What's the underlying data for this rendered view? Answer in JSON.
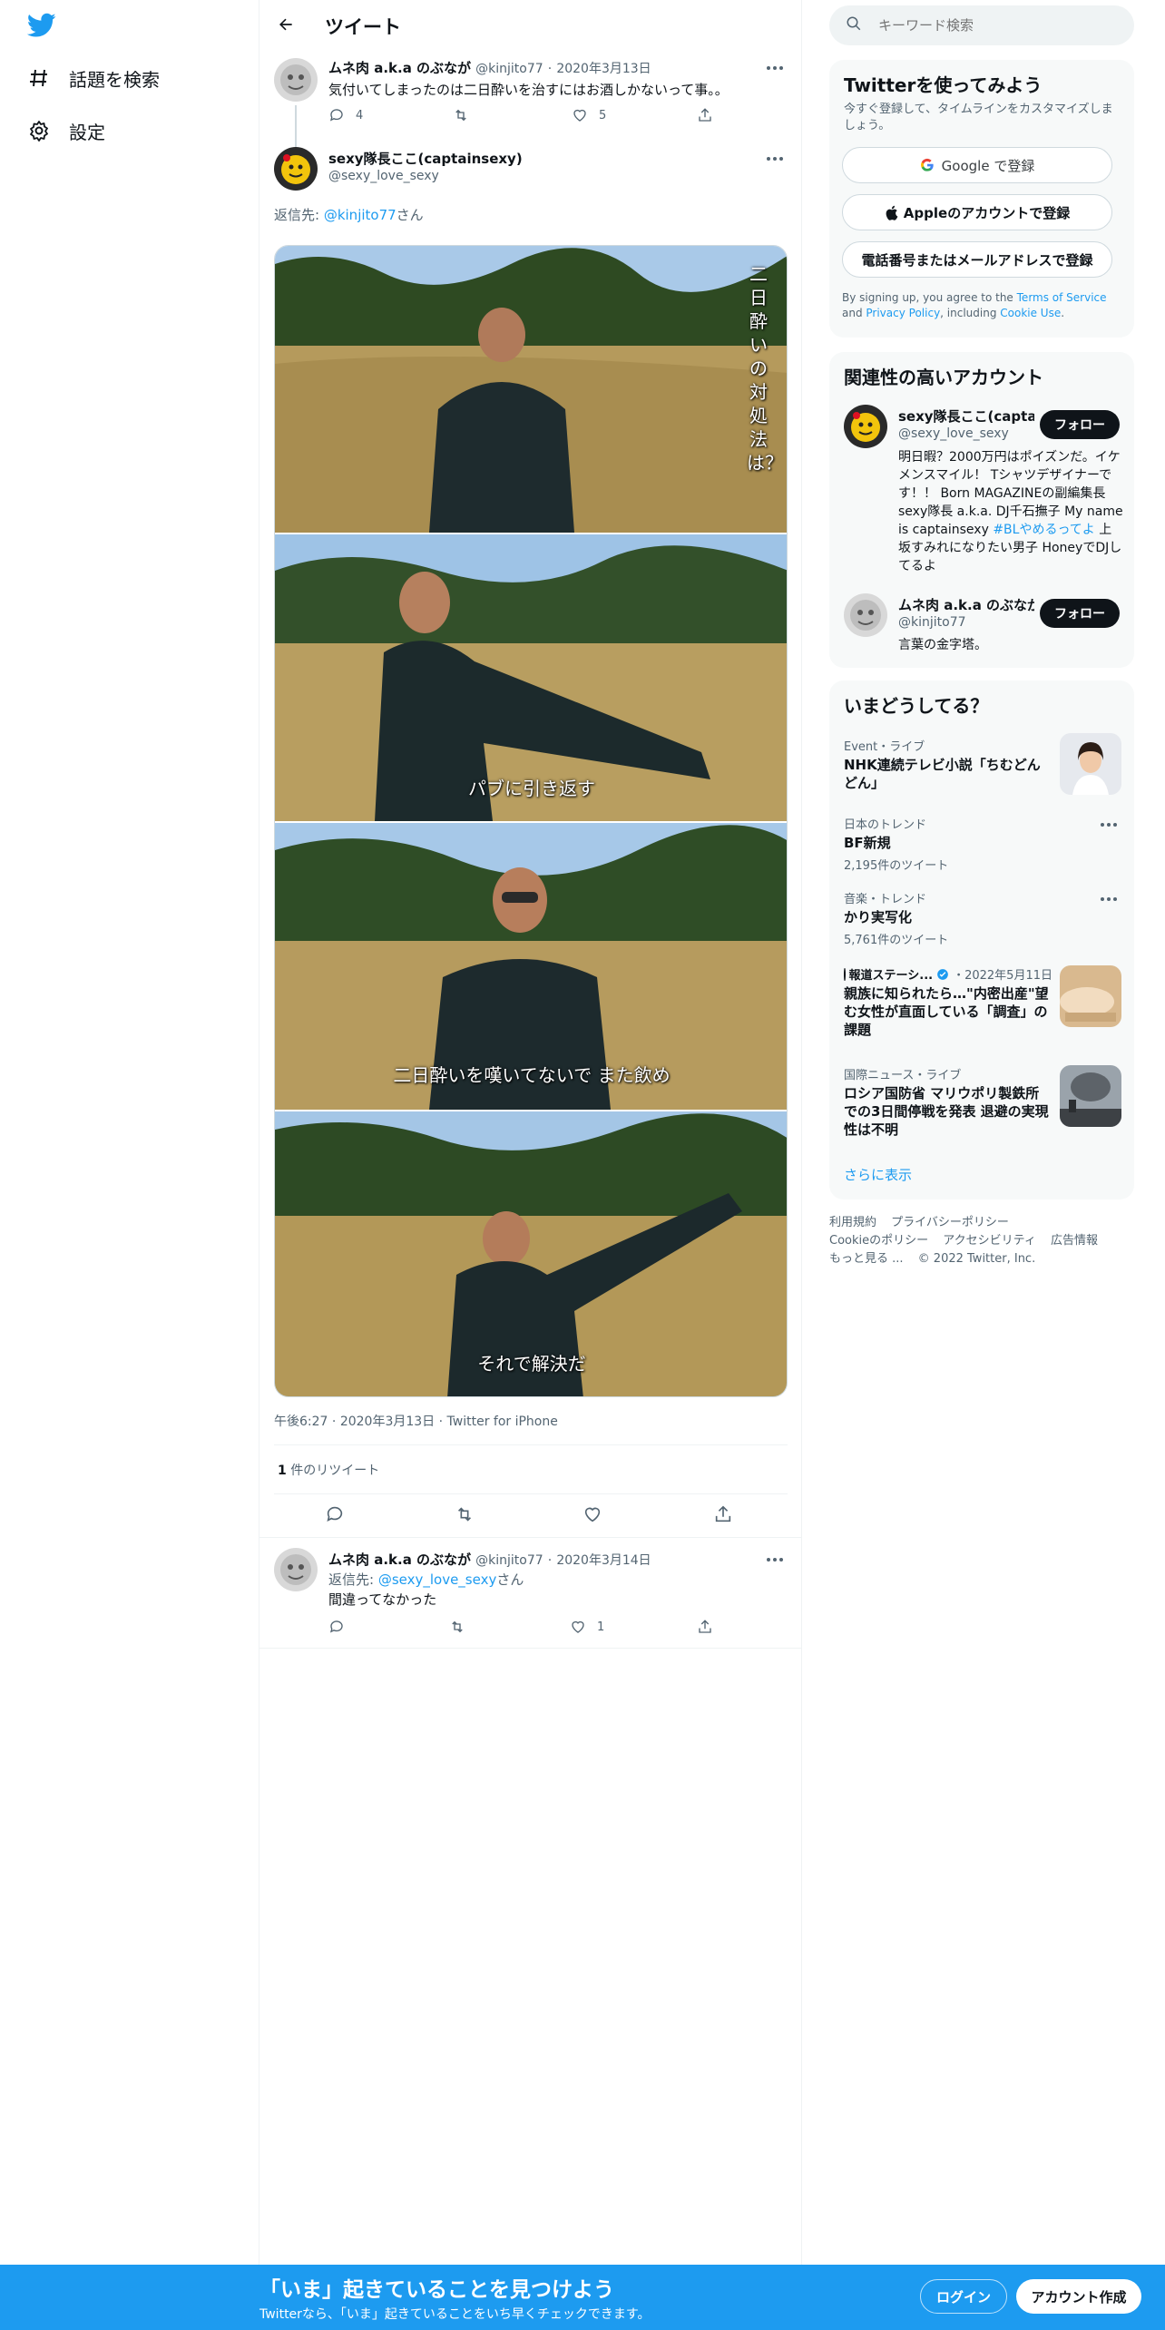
{
  "nav": {
    "explore_label": "話題を検索",
    "settings_label": "設定"
  },
  "header": {
    "title": "ツイート"
  },
  "parent_tweet": {
    "name": "ムネ肉 a.k.a のぶなが",
    "handle": "@kinjito77",
    "sep": "·",
    "date": "2020年3月13日",
    "text": "気付いてしまったのは二日酔いを治すにはお酒しかないって事。。",
    "reply_count": "4",
    "retweet_count": "",
    "like_count": "5"
  },
  "main_tweet": {
    "name": "sexy隊長ここ(captainsexy)",
    "handle": "@sexy_love_sexy",
    "reply_to_prefix": "返信先: ",
    "reply_to_handle": "@kinjito77",
    "reply_to_suffix": "さん",
    "captions": [
      "二日酔いの対処法は？",
      "パブに引き返す",
      "二日酔いを嘆いてないで また飲め",
      "それで解決だ"
    ],
    "timestamp": "午後6:27",
    "date": "2020年3月13日",
    "source": "Twitter for iPhone",
    "sep": "·",
    "retweet_count": "1",
    "retweet_label": " 件のリツイート"
  },
  "reply_tweet": {
    "name": "ムネ肉 a.k.a のぶなが",
    "handle": "@kinjito77",
    "sep": "·",
    "date": "2020年3月14日",
    "reply_to_prefix": "返信先: ",
    "reply_to_handle": "@sexy_love_sexy",
    "reply_to_suffix": "さん",
    "text": "間違ってなかった",
    "reply_count": "",
    "retweet_count": "",
    "like_count": "1"
  },
  "search": {
    "placeholder": "キーワード検索"
  },
  "signup_card": {
    "title": "Twitterを使ってみよう",
    "subtitle": "今すぐ登録して、タイムラインをカスタマイズしましょう。",
    "google_label": "Google で登録",
    "apple_label": "Appleのアカウントで登録",
    "phone_label": "電話番号またはメールアドレスで登録",
    "terms_pre": "By signing up, you agree to the ",
    "terms_link": "Terms of Service",
    "terms_and": " and ",
    "privacy_link": "Privacy Policy",
    "terms_including": ", including ",
    "cookie_link": "Cookie Use",
    "terms_end": "."
  },
  "related": {
    "title": "関連性の高いアカウント",
    "accounts": [
      {
        "name": "sexy隊長ここ(captain...",
        "handle": "@sexy_love_sexy",
        "bio_pre": "明日暇？2000万円はポイズンだ。イケメンスマイル！ Tシャツデザイナーです！！ Born MAGAZINEの副編集長sexy隊長 a.k.a. DJ千石撫子 My name is captainsexy ",
        "bio_tag": "#BLやめるってよ",
        "bio_post": " 上坂すみれになりたい男子 HoneyでDJしてるよ",
        "follow_label": "フォロー"
      },
      {
        "name": "ムネ肉 a.k.a のぶなが",
        "handle": "@kinjito77",
        "bio": "言葉の金字塔。",
        "follow_label": "フォロー"
      }
    ]
  },
  "trends": {
    "title": "いまどうしてる？",
    "items": [
      {
        "context": "Event・ライブ",
        "title": "NHK連続テレビ小説「ちむどんどん」"
      },
      {
        "context": "日本のトレンド",
        "title": "BF新規",
        "count": "2,195件のツイート"
      },
      {
        "context": "音楽・トレンド",
        "title": "かり実写化",
        "count": "5,761件のツイート"
      },
      {
        "context_source": "報道ステーシ...",
        "context_date": "2022年5月11日",
        "title": "親族に知られたら…\"内密出産\"望む女性が直面している「調査」の課題"
      },
      {
        "context": "国際ニュース・ライブ",
        "title": "ロシア国防省 マリウポリ製鉄所での3日間停戦を発表 退避の実現性は不明"
      }
    ],
    "show_more": "さらに表示"
  },
  "footer": {
    "links": [
      "利用規約",
      "プライバシーポリシー",
      "Cookieのポリシー",
      "アクセシビリティ",
      "広告情報",
      "もっと見る ..."
    ],
    "copyright": "© 2022 Twitter, Inc."
  },
  "banner": {
    "title": "「いま」起きていることを見つけよう",
    "subtitle": "Twitterなら、「いま」起きていることをいち早くチェックできます。",
    "login_label": "ログイン",
    "signup_label": "アカウント作成"
  },
  "colors": {
    "accent": "#1d9bf0",
    "text": "#0f1419",
    "muted": "#536471",
    "border": "#eff3f4"
  },
  "icons": [
    "twitter-bird-icon",
    "hashtag-icon",
    "gear-icon",
    "back-arrow-icon",
    "search-icon",
    "reply-icon",
    "retweet-icon",
    "like-icon",
    "share-icon",
    "more-icon",
    "google-icon",
    "apple-icon",
    "verified-icon"
  ]
}
